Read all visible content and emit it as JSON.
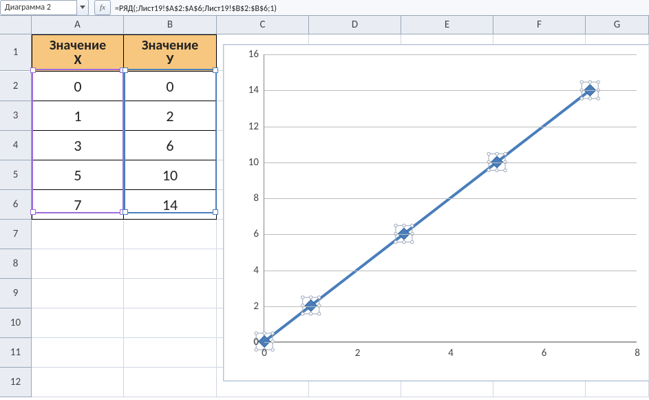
{
  "formula_bar": {
    "namebox_value": "Диаграмма 2",
    "fx_label": "fx",
    "formula": "=РЯД(;Лист19!$A$2:$A$6;Лист19!$B$2:$B$6;1)"
  },
  "columns": [
    "A",
    "B",
    "C",
    "D",
    "E",
    "F",
    "G"
  ],
  "rows": [
    "1",
    "2",
    "3",
    "4",
    "5",
    "6",
    "7",
    "8",
    "9",
    "10",
    "11",
    "12"
  ],
  "table": {
    "header_x_line1": "Значение",
    "header_x_line2": "Х",
    "header_y_line1": "Значение",
    "header_y_line2": "У",
    "rows": [
      {
        "x": "0",
        "y": "0"
      },
      {
        "x": "1",
        "y": "2"
      },
      {
        "x": "3",
        "y": "6"
      },
      {
        "x": "5",
        "y": "10"
      },
      {
        "x": "7",
        "y": "14"
      }
    ]
  },
  "chart_data": {
    "type": "line",
    "title": "",
    "xlabel": "",
    "ylabel": "",
    "x": [
      0,
      1,
      3,
      5,
      7
    ],
    "y": [
      0,
      2,
      6,
      10,
      14
    ],
    "xlim": [
      0,
      8
    ],
    "ylim": [
      0,
      16
    ],
    "xticks": [
      0,
      2,
      4,
      6,
      8
    ],
    "yticks": [
      0,
      2,
      4,
      6,
      8,
      10,
      12,
      14,
      16
    ],
    "line_color": "#4a7ebb",
    "series_selected": true
  }
}
